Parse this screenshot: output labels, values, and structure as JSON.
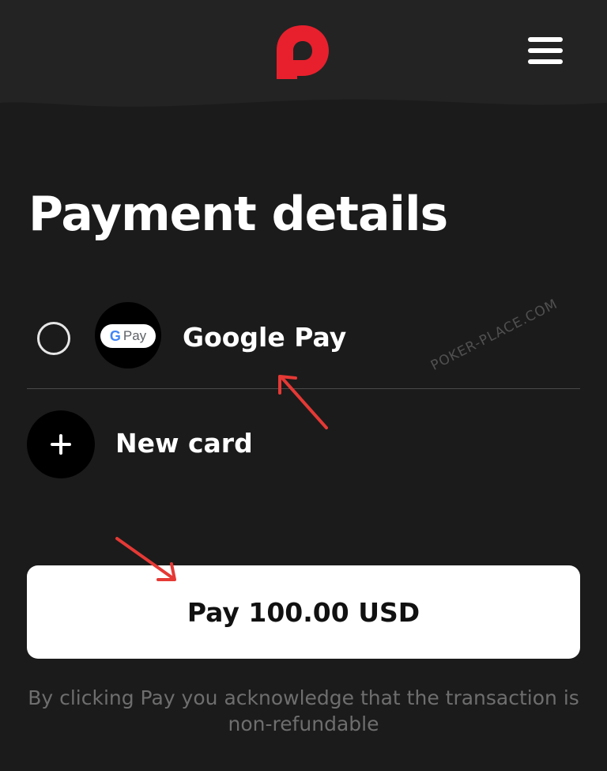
{
  "colors": {
    "background": "#1b1b1b",
    "header": "#232323",
    "brand": "#e8202d",
    "annotation_arrow": "#e53935",
    "pay_button_bg": "#ffffff",
    "disclaimer_text": "#6e6e6e"
  },
  "header": {
    "logo_icon": "brand-p-logo-icon",
    "menu_icon": "hamburger-menu-icon"
  },
  "page": {
    "title": "Payment details"
  },
  "payment_methods": [
    {
      "label": "Google Pay",
      "selected": false,
      "icon": "google-pay-icon",
      "badge_g": "G",
      "badge_text": "Pay"
    },
    {
      "label": "New card",
      "icon": "plus-icon"
    }
  ],
  "watermark": "POKER-PLACE.COM",
  "pay_button": {
    "label": "Pay 100.00 USD"
  },
  "disclaimer": "By clicking Pay you acknowledge that the transaction is non-refundable"
}
